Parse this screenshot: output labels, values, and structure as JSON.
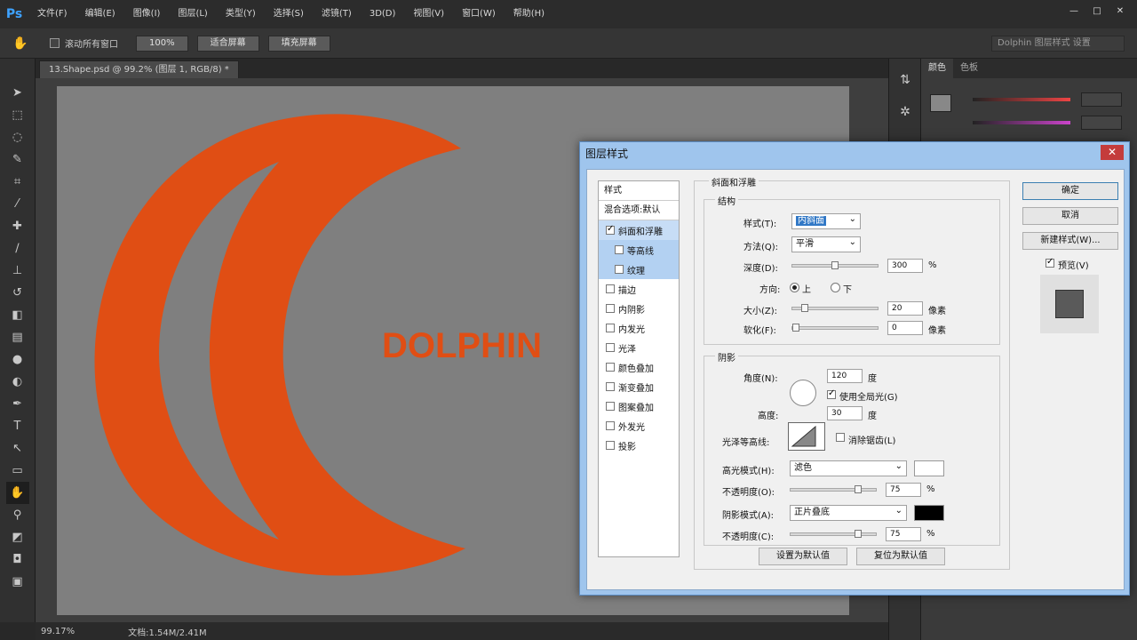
{
  "app": {
    "logo": "Ps",
    "menu": [
      "文件(F)",
      "编辑(E)",
      "图像(I)",
      "图层(L)",
      "类型(Y)",
      "选择(S)",
      "滤镜(T)",
      "3D(D)",
      "视图(V)",
      "窗口(W)",
      "帮助(H)"
    ],
    "window_buttons": [
      "—",
      "□",
      "✕"
    ]
  },
  "options_bar": {
    "scroll_all_label": "滚动所有窗口",
    "zoom_100": "100%",
    "fit_screen": "适合屏幕",
    "fill_screen": "填充屏幕",
    "workspace": "Dolphin 图层样式 设置"
  },
  "document": {
    "tab_title": "13.Shape.psd @ 99.2% (图层 1, RGB/8) *",
    "canvas_text": "DOLPHIN",
    "status_zoom": "99.17%",
    "status_doc": "文档:1.54M/2.41M"
  },
  "panels": {
    "tabs": [
      "颜色",
      "色板"
    ]
  },
  "colors": {
    "shape": "#e04e14",
    "canvas": "#7f7f7f"
  },
  "dialog": {
    "title": "图层样式",
    "close": "✕",
    "style_list": {
      "header": "样式",
      "blend": "混合选项:默认",
      "items": [
        {
          "label": "斜面和浮雕",
          "checked": true,
          "selected": true,
          "sub": false
        },
        {
          "label": "等高线",
          "checked": false,
          "selected": false,
          "sub": true
        },
        {
          "label": "纹理",
          "checked": false,
          "selected": false,
          "sub": true
        },
        {
          "label": "描边",
          "checked": false,
          "selected": false,
          "sub": false
        },
        {
          "label": "内阴影",
          "checked": false,
          "selected": false,
          "sub": false
        },
        {
          "label": "内发光",
          "checked": false,
          "selected": false,
          "sub": false
        },
        {
          "label": "光泽",
          "checked": false,
          "selected": false,
          "sub": false
        },
        {
          "label": "颜色叠加",
          "checked": false,
          "selected": false,
          "sub": false
        },
        {
          "label": "渐变叠加",
          "checked": false,
          "selected": false,
          "sub": false
        },
        {
          "label": "图案叠加",
          "checked": false,
          "selected": false,
          "sub": false
        },
        {
          "label": "外发光",
          "checked": false,
          "selected": false,
          "sub": false
        },
        {
          "label": "投影",
          "checked": false,
          "selected": false,
          "sub": false
        }
      ]
    },
    "bevel": {
      "group_title": "斜面和浮雕",
      "structure_title": "结构",
      "style_label": "样式(T):",
      "style_value": "内斜面",
      "technique_label": "方法(Q):",
      "technique_value": "平滑",
      "depth_label": "深度(D):",
      "depth_value": "300",
      "depth_unit": "%",
      "direction_label": "方向:",
      "up_label": "上",
      "down_label": "下",
      "size_label": "大小(Z):",
      "size_value": "20",
      "size_unit": "像素",
      "soften_label": "软化(F):",
      "soften_value": "0",
      "soften_unit": "像素"
    },
    "shading": {
      "title": "阴影",
      "angle_label": "角度(N):",
      "angle_value": "120",
      "angle_unit": "度",
      "global_light": "使用全局光(G)",
      "altitude_label": "高度:",
      "altitude_value": "30",
      "altitude_unit": "度",
      "gloss_label": "光泽等高线:",
      "anti_alias": "消除锯齿(L)",
      "highlight_mode_label": "高光模式(H):",
      "highlight_mode": "滤色",
      "highlight_opacity_label": "不透明度(O):",
      "highlight_opacity": "75",
      "shadow_mode_label": "阴影模式(A):",
      "shadow_mode": "正片叠底",
      "shadow_opacity_label": "不透明度(C):",
      "shadow_opacity": "75",
      "percent": "%",
      "highlight_color": "#ffffff",
      "shadow_color": "#000000"
    },
    "buttons": {
      "set_default": "设置为默认值",
      "reset_default": "复位为默认值",
      "ok": "确定",
      "cancel": "取消",
      "new_style": "新建样式(W)...",
      "preview": "预览(V)"
    }
  }
}
